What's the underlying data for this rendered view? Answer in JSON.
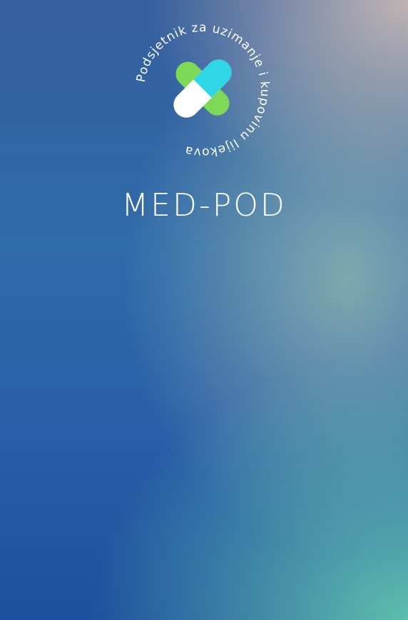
{
  "app": {
    "name": "MED-POD",
    "logo_text": "Podsjetnik za uzimanje i kupovinu lijekova",
    "logo_icon": "pill-cross-icon"
  },
  "colors": {
    "pill_green": "#7ed957",
    "pill_cyan": "#2fd6e6",
    "capsule_white": "#ffffff",
    "title_text": "#ffffff"
  }
}
